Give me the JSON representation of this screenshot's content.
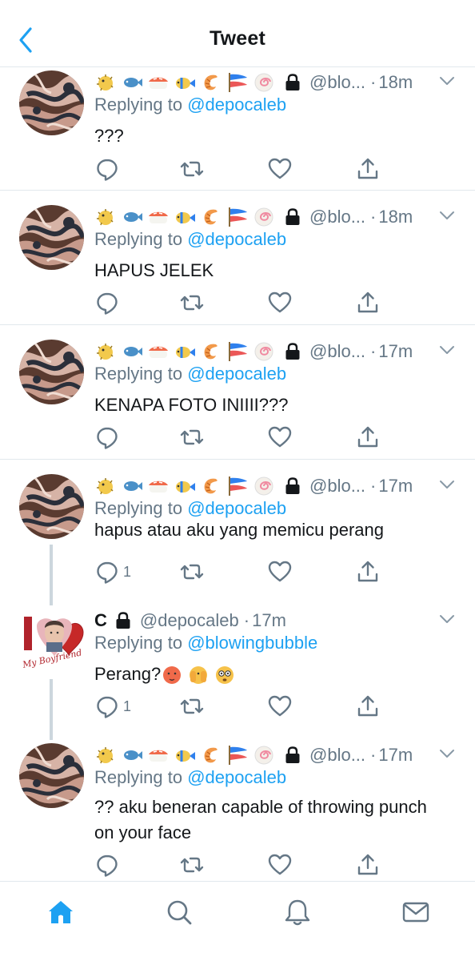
{
  "header": {
    "title": "Tweet",
    "back_icon": "chevron-left-icon"
  },
  "colors": {
    "accent": "#1da1f2",
    "muted": "#657786",
    "divider": "#e1e8ed",
    "text": "#14171a"
  },
  "tweets": [
    {
      "author": "🐡🐟🍣🐠🦐🎏🍥🔒",
      "handle": "@blo...",
      "time": "18m",
      "replying_prefix": "Replying to",
      "replying_to": "@depocaleb",
      "text": "???",
      "reply_count": ""
    },
    {
      "author": "🐡🐟🍣🐠🦐🎏🍥🔒",
      "handle": "@blo...",
      "time": "18m",
      "replying_prefix": "Replying to",
      "replying_to": "@depocaleb",
      "text": "HAPUS JELEK",
      "reply_count": ""
    },
    {
      "author": "🐡🐟🍣🐠🦐🎏🍥🔒",
      "handle": "@blo...",
      "time": "17m",
      "replying_prefix": "Replying to",
      "replying_to": "@depocaleb",
      "text": "KENAPA FOTO INIIII???",
      "reply_count": ""
    },
    {
      "author": "🐡🐟🍣🐠🦐🎏🍥🔒",
      "handle": "@blo...",
      "time": "17m",
      "replying_prefix": "Replying to",
      "replying_to": "@depocaleb",
      "text": "hapus atau aku yang memicu perang",
      "reply_count": "1"
    },
    {
      "author": "C",
      "handle": "@depocaleb",
      "time": "17m",
      "replying_prefix": "Replying to",
      "replying_to": "@blowingbubble",
      "text": "Perang?🥵🫣😳",
      "reply_count": "1"
    },
    {
      "author": "🐡🐟🍣🐠🦐🎏🍥🔒",
      "handle": "@blo...",
      "time": "17m",
      "replying_prefix": "Replying to",
      "replying_to": "@depocaleb",
      "text": "?? aku beneran capable of throwing punch on your face",
      "reply_count": ""
    }
  ],
  "avatar_c_logo_text": "I ♥ My Boyfriend",
  "tabbar": {
    "items": [
      "home-icon",
      "search-icon",
      "notifications-icon",
      "messages-icon"
    ]
  }
}
